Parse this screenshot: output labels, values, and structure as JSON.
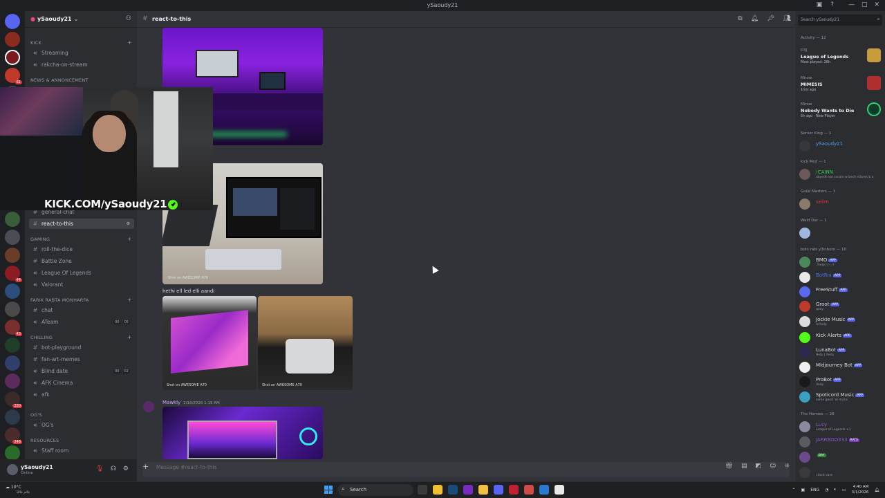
{
  "window": {
    "title": "ySaoudy21"
  },
  "server": {
    "name": "ySaoudy21"
  },
  "sidebar": {
    "categories": [
      {
        "label": "KICK"
      },
      {
        "label": "NEWS & ANNONCEMENT"
      },
      {
        "label": "GAMING"
      },
      {
        "label": "FARIK RABTA MONHARFA"
      },
      {
        "label": "CHILLING"
      },
      {
        "label": "OG's"
      },
      {
        "label": "RESOURCES"
      }
    ],
    "channels": [
      {
        "label": "Streaming"
      },
      {
        "label": "rakcha-on-stream"
      },
      {
        "label": "general-chat"
      },
      {
        "label": "react-to-this"
      },
      {
        "label": "roll-the-dice"
      },
      {
        "label": "Battle Zone"
      },
      {
        "label": "League Of Legends"
      },
      {
        "label": "Valorant"
      },
      {
        "label": "chat"
      },
      {
        "label": "ATeam"
      },
      {
        "label": "bot-playground"
      },
      {
        "label": "fan-art-memes"
      },
      {
        "label": "Blind date"
      },
      {
        "label": "AFK Cinema"
      },
      {
        "label": "afk"
      },
      {
        "label": "OG's"
      },
      {
        "label": "Staff room"
      }
    ],
    "voice_counts": {
      "ateam": [
        "00",
        "05"
      ],
      "blind_date": [
        "00",
        "02"
      ]
    }
  },
  "overlay": {
    "kick_text": "KICK.COM/ySaoudy21"
  },
  "user": {
    "name": "ySaoudy21",
    "status": "Online"
  },
  "chat": {
    "channel": "react-to-this",
    "messages": [
      {
        "text": "hethi ell led elli aandi"
      },
      {
        "author": "Mawkly",
        "timestamp": "2/18/2026 1:19 AM"
      }
    ],
    "watermark": "Shot on AWESOME A70",
    "composer_placeholder": "Message #react-to-this"
  },
  "members": {
    "search_placeholder": "Search ySaoudy21",
    "activity_header": "Activity — 12",
    "activities": [
      {
        "who": "D3J",
        "game": "League of Legends",
        "sub": "Most played: 28h"
      },
      {
        "who": "Mirow",
        "game": "MIMESIS",
        "sub": "1mo ago"
      },
      {
        "who": "Mirow",
        "game": "Nobody Wants to Die",
        "sub": "5h ago · New Player"
      }
    ],
    "groups": [
      {
        "label": "Server King — 1",
        "members": [
          {
            "name": "ySaoudy21",
            "status": ""
          }
        ]
      },
      {
        "label": "kick Mod — 1",
        "members": [
          {
            "name": "!CAINN",
            "status": "abyedh kol cocain w bech n3ares b a"
          }
        ]
      },
      {
        "label": "Guild Masters — 1",
        "members": [
          {
            "name": "selim",
            "status": ""
          }
        ]
      },
      {
        "label": "Weld Dar — 1",
        "members": [
          {
            "name": "",
            "status": ""
          }
        ]
      },
      {
        "label": "bots rabi y3inhom — 10",
        "members": [
          {
            "name": "BMO",
            "status": "./help | [-_-]"
          },
          {
            "name": "BotRix",
            "status": ""
          },
          {
            "name": "FreeStuff",
            "status": ""
          },
          {
            "name": "Groot",
            "status": "/play"
          },
          {
            "name": "Jockie Music",
            "status": "m!help"
          },
          {
            "name": "Kick Alerts",
            "status": ""
          },
          {
            "name": "LunaBot",
            "status": "Help | /help"
          },
          {
            "name": "Midjourney Bot",
            "status": ""
          },
          {
            "name": "ProBot",
            "status": "/help"
          },
          {
            "name": "Spoticord Music",
            "status": "some good 'ol music"
          }
        ]
      },
      {
        "label": "The Homies — 28",
        "members": [
          {
            "name": "Lucy",
            "status": "League of Legends +1"
          },
          {
            "name": "JARRBOO333",
            "status": ""
          },
          {
            "name": "",
            "status": ""
          },
          {
            "name": "",
            "status": "i dont care"
          }
        ]
      }
    ],
    "app_tag": "APP",
    "tags": {
      "jarrboo": "RATS",
      "bay": "BAY"
    }
  },
  "taskbar": {
    "weather": "10°C",
    "weather_sub": "غائم غالبًا",
    "search": "Search",
    "lang": "ENG",
    "time": "4:40 AM",
    "date": "3/1/2026"
  },
  "colors": {
    "accent": "#5865f2",
    "kick_green": "#53fc18",
    "bg": "#313338",
    "sidebar": "#2b2d31"
  }
}
